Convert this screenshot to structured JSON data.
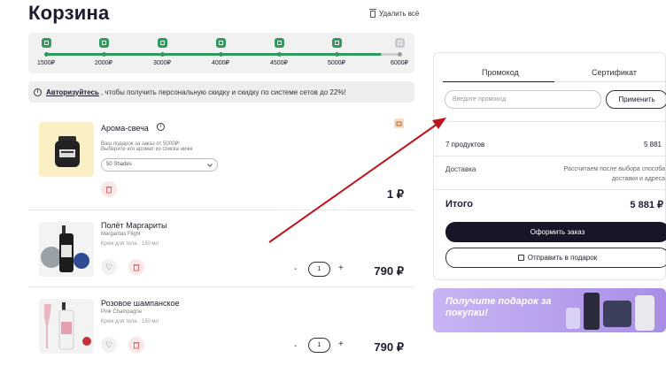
{
  "page": {
    "title": "Корзина",
    "delete_all": "Удалить всё"
  },
  "progress": {
    "milestones": [
      {
        "amount": "1500₽",
        "reached": true
      },
      {
        "amount": "2000₽",
        "reached": true
      },
      {
        "amount": "3000₽",
        "reached": true
      },
      {
        "amount": "4000₽",
        "reached": true
      },
      {
        "amount": "4500₽",
        "reached": true
      },
      {
        "amount": "5000₽",
        "reached": true
      },
      {
        "amount": "6000₽",
        "reached": false
      }
    ]
  },
  "auth_banner": {
    "link": "Авторизуйтесь",
    "text": ", чтобы получить персональную скидку и скидку по системе сетов до 22%!"
  },
  "items": [
    {
      "name": "Арома-свеча",
      "note1": "Ваш подарок за заказ от 5000₽!",
      "note2": "Выберите его аромат из списка ниже",
      "select_value": "50 Shades",
      "price": "1 ₽"
    },
    {
      "name": "Полёт Маргариты",
      "subname": "Margaritas Flight",
      "meta": "Крем для тела · 150 мл",
      "qty": "1",
      "price": "790 ₽"
    },
    {
      "name": "Розовое шампанское",
      "subname": "Pink Champagne",
      "meta": "Крем для тела · 150 мл",
      "qty": "1",
      "price": "790 ₽"
    }
  ],
  "qty_controls": {
    "minus": "-",
    "plus": "+"
  },
  "summary": {
    "tab_promo": "Промокод",
    "tab_cert": "Сертификат",
    "promo_placeholder": "Введите промокод",
    "apply": "Применить",
    "products_label": "7 продуктов",
    "products_value": "5 881",
    "delivery_label": "Доставка",
    "delivery_note_1": "Рассчитаем после выбора способа",
    "delivery_note_2": "доставки и адреса",
    "total_label": "Итого",
    "total_value": "5 881 ₽",
    "order_button": "Оформить заказ",
    "gift_button": "Отправить в подарок"
  },
  "promo_banner": {
    "text": "Получите подарок за покупки!"
  },
  "colors": {
    "accent_green": "#2f9a5c",
    "dark": "#161628",
    "annotation_red": "#c0141c"
  }
}
